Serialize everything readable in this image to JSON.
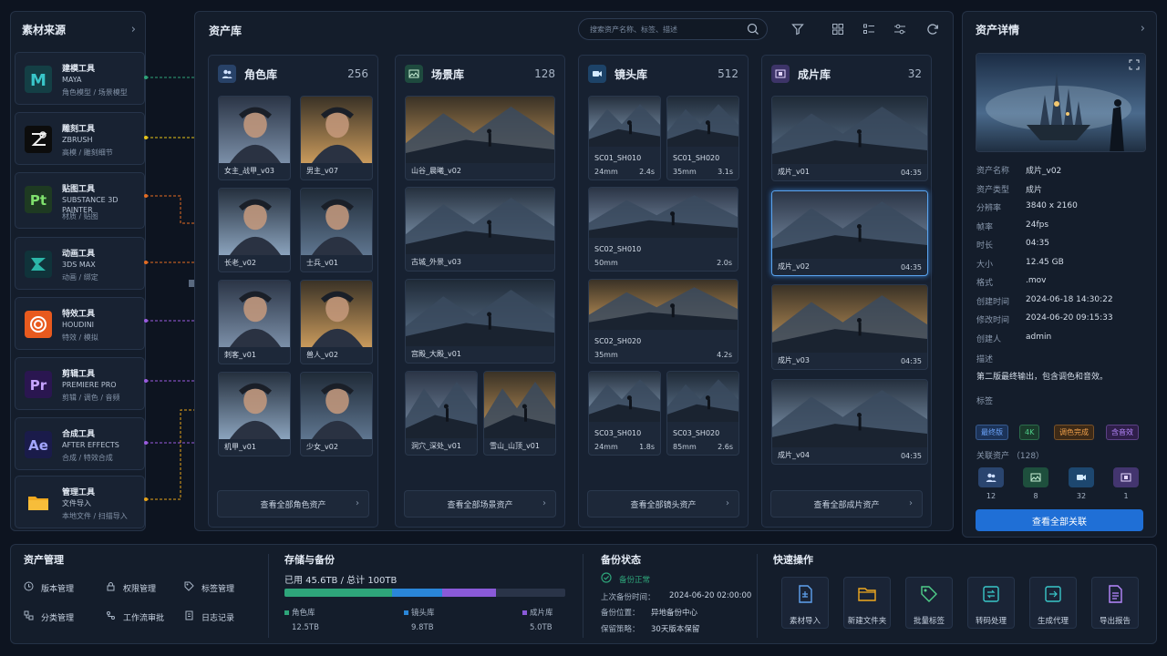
{
  "sources": {
    "title": "素材来源",
    "tools": [
      {
        "cat": "建模工具",
        "name": "MAYA",
        "desc": "角色模型 / 场景模型",
        "logo": "M",
        "color": "#2a8c90"
      },
      {
        "cat": "雕刻工具",
        "name": "ZBRUSH",
        "desc": "高模 / 雕刻细节",
        "logo": "Z",
        "color": "#e8a319"
      },
      {
        "cat": "贴图工具",
        "name": "SUBSTANCE 3D PAINTER",
        "desc": "材质 / 贴图",
        "logo": "Pt",
        "color": "#e56c22"
      },
      {
        "cat": "动画工具",
        "name": "3DS MAX",
        "desc": "动画 / 绑定",
        "logo": "3",
        "color": "#e56c22"
      },
      {
        "cat": "特效工具",
        "name": "HOUDINI",
        "desc": "特效 / 模拟",
        "logo": "H",
        "color": "#9b5ce0"
      },
      {
        "cat": "剪辑工具",
        "name": "PREMIERE PRO",
        "desc": "剪辑 / 调色 / 音频",
        "logo": "Pr",
        "color": "#9b5ce0"
      },
      {
        "cat": "合成工具",
        "name": "AFTER EFFECTS",
        "desc": "合成 / 特效合成",
        "logo": "Ae",
        "color": "#9b5ce0"
      },
      {
        "cat": "管理工具",
        "name": "文件导入",
        "desc": "本地文件 / 扫描导入",
        "logo": "F",
        "color": "#e8a319"
      }
    ]
  },
  "library": {
    "title": "资产库",
    "search_placeholder": "搜索资产名称、标签、描述",
    "columns": [
      {
        "name": "角色库",
        "count": "256",
        "view_all": "查看全部角色资产",
        "accent": "#4b83d8",
        "items": [
          "女主_战甲_v03",
          "男主_v07",
          "长老_v02",
          "士兵_v01",
          "刺客_v01",
          "兽人_v02",
          "机甲_v01",
          "少女_v02"
        ]
      },
      {
        "name": "场景库",
        "count": "128",
        "view_all": "查看全部场景资产",
        "accent": "#2e9b5b",
        "items": [
          "山谷_晨曦_v02",
          "古城_外景_v03",
          "宫殿_大殿_v01",
          "洞穴_深处_v01",
          "雪山_山顶_v01"
        ]
      },
      {
        "name": "镜头库",
        "count": "512",
        "view_all": "查看全部镜头资产",
        "accent": "#2a86d8",
        "items": [
          {
            "name": "SC01_SH010",
            "lens": "24mm",
            "dur": "2.4s"
          },
          {
            "name": "SC01_SH020",
            "lens": "35mm",
            "dur": "3.1s"
          },
          {
            "name": "SC02_SH010",
            "lens": "50mm",
            "dur": "2.0s"
          },
          {
            "name": "SC02_SH020",
            "lens": "35mm",
            "dur": "4.2s"
          },
          {
            "name": "SC03_SH010",
            "lens": "24mm",
            "dur": "1.8s"
          },
          {
            "name": "SC03_SH020",
            "lens": "85mm",
            "dur": "2.6s"
          }
        ]
      },
      {
        "name": "成片库",
        "count": "32",
        "view_all": "查看全部成片资产",
        "accent": "#8a5ad8",
        "items": [
          {
            "name": "成片_v01",
            "dur": "04:35"
          },
          {
            "name": "成片_v02",
            "dur": "04:35"
          },
          {
            "name": "成片_v03",
            "dur": "04:35"
          },
          {
            "name": "成片_v04",
            "dur": "04:35"
          }
        ]
      }
    ]
  },
  "detail": {
    "title": "资产详情",
    "rows": [
      {
        "k": "资产名称",
        "v": "成片_v02"
      },
      {
        "k": "资产类型",
        "v": "成片"
      },
      {
        "k": "分辨率",
        "v": "3840 x 2160"
      },
      {
        "k": "帧率",
        "v": "24fps"
      },
      {
        "k": "时长",
        "v": "04:35"
      },
      {
        "k": "大小",
        "v": "12.45 GB"
      },
      {
        "k": "格式",
        "v": ".mov"
      },
      {
        "k": "创建时间",
        "v": "2024-06-18 14:30:22"
      },
      {
        "k": "修改时间",
        "v": "2024-06-20 09:15:33"
      },
      {
        "k": "创建人",
        "v": "admin"
      }
    ],
    "desc_label": "描述",
    "desc": "第二版最终输出，包含调色和音效。",
    "tags_label": "标签",
    "tags": [
      "最终版",
      "4K",
      "调色完成",
      "含音效"
    ],
    "related_label": "关联资产  （128）",
    "related": [
      "12",
      "8",
      "32",
      "1"
    ],
    "button": "查看全部关联"
  },
  "bottom": {
    "asset_mgmt": {
      "title": "资产管理",
      "items": [
        "版本管理",
        "权限管理",
        "标签管理",
        "分类管理",
        "工作流审批",
        "日志记录"
      ]
    },
    "storage": {
      "title": "存储与备份",
      "used": "已用 45.6TB / 总计 100TB",
      "segments": [
        {
          "name": "角色库",
          "size": "12.5TB",
          "color": "#2ea57a",
          "frac": 0.125
        },
        {
          "name": "镜头库",
          "size": "9.8TB",
          "color": "#2a86d8",
          "frac": 0.098
        },
        {
          "name": "成片库",
          "size": "5.0TB",
          "color": "#8a5ad8",
          "frac": 0.05
        }
      ],
      "scene_total": "0.18"
    },
    "backup": {
      "title": "备份状态",
      "status": "备份正常",
      "last_label": "上次备份时间：",
      "last": "2024-06-20 02:00:00",
      "loc_label": "备份位置：",
      "loc": "异地备份中心",
      "policy_label": "保留策略：",
      "policy": "30天版本保留"
    },
    "quick": {
      "title": "快速操作",
      "items": [
        "素材导入",
        "新建文件夹",
        "批量标签",
        "转码处理",
        "生成代理",
        "导出报告"
      ]
    }
  }
}
